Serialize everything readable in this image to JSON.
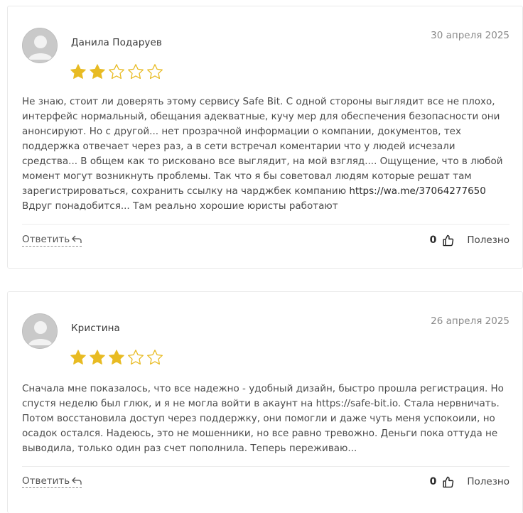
{
  "colors": {
    "star_filled": "#e8bb23",
    "star_empty_outline": "#e8bb23",
    "avatar_bg": "#c9c9c9",
    "avatar_fg": "#f2f2f2"
  },
  "reviews": [
    {
      "author": "Данила Подаруев",
      "date": "30 апреля 2025",
      "rating": 2,
      "max_rating": 5,
      "text_before_link": "Не знаю, стоит ли доверять этому сервису Safe Bit. С одной стороны выглядит все не плохо, интерфейс нормальный, обещания адекватные, кучу мер для обеспечения безопасности они анонсируют. Но с другой... нет прозрачной информации о компании, документов, тех поддержка отвечает через раз, а в сети встречал коментарии что у людей исчезали средства... В общем как то рисковано все выглядит, на мой взгляд.... Ощущение, что в любой момент могут возникнуть проблемы. Так что я бы советовал людям которые решат там зарегистрироваться, сохранить ссылку на чарджбек компанию ",
      "link": "https://wa.me/37064277650",
      "text_after_link": " Вдруг понадобится... Там реально хорошие юристы работают",
      "reply_label": "Ответить",
      "likes": "0",
      "helpful_label": "Полезно"
    },
    {
      "author": "Кристина",
      "date": "26 апреля 2025",
      "rating": 3,
      "max_rating": 5,
      "text_before_link": "Сначала мне показалось, что все надежно - удобный дизайн, быстро прошла регистрация. Но спустя неделю был глюк, и я не могла войти в акаунт на https://safe-bit.io. Стала нервничать. Потом восстановила доступ через поддержку, они помогли и даже чуть меня успокоили, но осадок остался. Надеюсь, это не мошенники, но все равно тревожно. Деньги пока оттуда не выводила, только один раз счет пополнила. Теперь переживаю...",
      "link": "",
      "text_after_link": "",
      "reply_label": "Ответить",
      "likes": "0",
      "helpful_label": "Полезно"
    }
  ]
}
